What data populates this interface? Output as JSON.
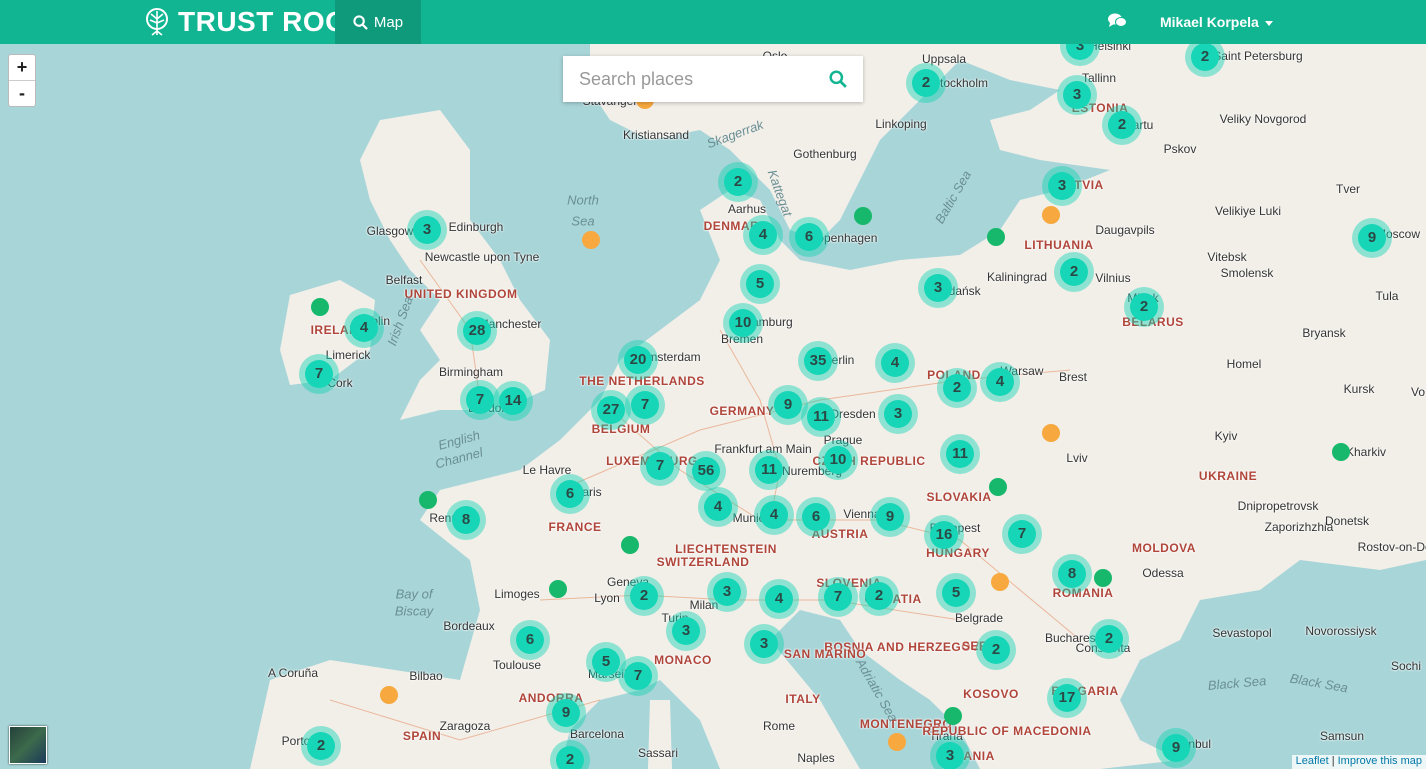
{
  "header": {
    "brand": "TRUST ROOTS",
    "nav_map_label": "Map",
    "user_name": "Mikael Korpela"
  },
  "search": {
    "placeholder": "Search places"
  },
  "zoom": {
    "in_label": "+",
    "out_label": "-"
  },
  "attribution": {
    "leaflet": "Leaflet",
    "separator": "|",
    "improve": "Improve this map"
  },
  "colors": {
    "brand": "#12b591",
    "cluster": "#17d6b7",
    "dot_green": "#17b86b",
    "dot_orange": "#f7a83e",
    "water": "#a8d5d8",
    "land": "#f2efe9"
  },
  "icons": {
    "brand_logo": "tree-icon",
    "nav": "search-icon",
    "messages": "chat-icon",
    "search": "search-icon",
    "layers": "satellite-layer-icon"
  },
  "countries": [
    "UNITED KINGDOM",
    "IRELAND",
    "THE NETHERLANDS",
    "BELGIUM",
    "LUXEMBOURG",
    "GERMANY",
    "FRANCE",
    "LIECHTENSTEIN",
    "SWITZERLAND",
    "AUSTRIA",
    "CZECH REPUBLIC",
    "SLOVAKIA",
    "HUNGARY",
    "POLAND",
    "LITHUANIA",
    "LATVIA",
    "ESTONIA",
    "BELARUS",
    "UKRAINE",
    "MOLDOVA",
    "ROMANIA",
    "SLOVENIA",
    "CROATIA",
    "BOSNIA AND HERZEGOVINA",
    "SERBIA",
    "KOSOVO",
    "MONTENEGRO",
    "REPUBLIC OF MACEDONIA",
    "BULGARIA",
    "ALBANIA",
    "ITALY",
    "SAN MARINO",
    "MONACO",
    "ANDORRA",
    "SPAIN",
    "DENMARK"
  ],
  "cities": [
    "Helsinki",
    "Saint Petersburg",
    "Tallinn",
    "Tartu",
    "Veliky Novgorod",
    "Pskov",
    "Tver",
    "Velikiye Luki",
    "Moscow",
    "Daugavpils",
    "Vitebsk",
    "Smolensk",
    "Vilnius",
    "Minsk",
    "Tula",
    "Bryansk",
    "Kaliningrad",
    "Gdańsk",
    "Warsaw",
    "Brest",
    "Homel",
    "Kursk",
    "Vo",
    "Kyiv",
    "Kharkiv",
    "Lviv",
    "Dnipropetrovsk",
    "Zaporizhzhia",
    "Donetsk",
    "Rostov-on-Don",
    "Odessa",
    "Sevastopol",
    "Novorossiysk",
    "Sochi",
    "Samsun",
    "Constanta",
    "Bucharest",
    "Istanbul",
    "Uppsala",
    "Stockholm",
    "Oslo",
    "Stavanger",
    "Kristiansand",
    "Linkoping",
    "Gothenburg",
    "Aarhus",
    "Copenhagen",
    "Hamburg",
    "Bremen",
    "Berlin",
    "Amsterdam",
    "Dresden",
    "Prague",
    "Frankfurt am Main",
    "Nuremberg",
    "Munich",
    "Vienna",
    "Budapest",
    "Belgrade",
    "Tirana",
    "Naples",
    "Sassari",
    "Rome",
    "Milan",
    "Turin",
    "Geneva",
    "Lyon",
    "Marseille",
    "Toulouse",
    "Bordeaux",
    "Limoges",
    "Paris",
    "Le Havre",
    "Rennes",
    "Bilbao",
    "A Coruña",
    "Porto",
    "Zaragoza",
    "Barcelona",
    "London",
    "Birmingham",
    "Manchester",
    "Newcastle upon Tyne",
    "Edinburgh",
    "Glasgow",
    "Belfast",
    "Dublin",
    "Limerick",
    "Cork"
  ],
  "seas": [
    "North Sea",
    "Skagerrak",
    "Kattegat",
    "Baltic Sea",
    "Irish Sea",
    "English Channel",
    "Bay of Biscay",
    "Adriatic Sea",
    "Black Sea",
    "Black Sea"
  ],
  "clusters": [
    "3",
    "2",
    "3",
    "2",
    "2",
    "3",
    "2",
    "3",
    "4",
    "6",
    "9",
    "2",
    "3",
    "2",
    "4",
    "10",
    "5",
    "35",
    "20",
    "4",
    "28",
    "27",
    "7",
    "4",
    "2",
    "7",
    "14",
    "9",
    "7",
    "11",
    "3",
    "11",
    "7",
    "56",
    "10",
    "4",
    "11",
    "4",
    "9",
    "6",
    "16",
    "6",
    "8",
    "7",
    "2",
    "3",
    "4",
    "7",
    "2",
    "5",
    "8",
    "3",
    "3",
    "2",
    "2",
    "6",
    "5",
    "7",
    "17",
    "9",
    "9",
    "2",
    "3",
    "2"
  ]
}
